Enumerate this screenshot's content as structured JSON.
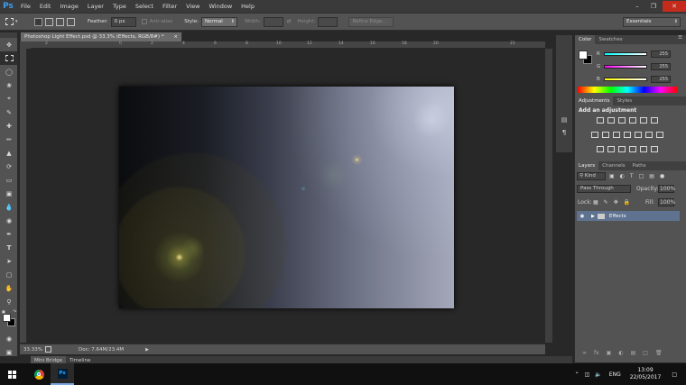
{
  "app": {
    "logo": "Ps"
  },
  "menu": [
    "File",
    "Edit",
    "Image",
    "Layer",
    "Type",
    "Select",
    "Filter",
    "View",
    "Window",
    "Help"
  ],
  "options": {
    "feather_label": "Feather:",
    "feather_value": "0 px",
    "antialias_label": "Anti-alias",
    "style_label": "Style:",
    "style_value": "Normal",
    "width_label": "Width:",
    "height_label": "Height:",
    "refine_label": "Refine Edge...",
    "workspace": "Essentials"
  },
  "document": {
    "tab_title": "Photoshop Light Effect.psd @ 33.3% (Effects, RGB/8#) *"
  },
  "ruler": {
    "top_ticks": [
      "2",
      "0",
      "2",
      "4",
      "6",
      "8",
      "10",
      "12",
      "14",
      "16",
      "18",
      "20",
      "21"
    ]
  },
  "status": {
    "zoom": "33.33%",
    "doc": "Doc: 7.64M/23.4M"
  },
  "bottom_tabs": [
    "Mini Bridge",
    "Timeline"
  ],
  "color_panel": {
    "tabs": [
      "Color",
      "Swatches"
    ],
    "r_label": "R",
    "r": "255",
    "g_label": "G",
    "g": "255",
    "b_label": "B",
    "b": "255"
  },
  "adjustments_panel": {
    "tabs": [
      "Adjustments",
      "Styles"
    ],
    "heading": "Add an adjustment"
  },
  "layers_panel": {
    "tabs": [
      "Layers",
      "Channels",
      "Paths"
    ],
    "kind": "Kind",
    "blend_mode": "Pass Through",
    "opacity_label": "Opacity:",
    "opacity": "100%",
    "lock_label": "Lock:",
    "fill_label": "Fill:",
    "fill": "100%",
    "layer_name": "Effects"
  },
  "taskbar": {
    "language": "ENG",
    "time": "13:09",
    "date": "22/05/2017",
    "ps_label": "Ps"
  },
  "colors": {
    "accent_blue": "#3e9cf0",
    "selected_layer": "#5f7390",
    "close_red": "#c42b1c"
  }
}
